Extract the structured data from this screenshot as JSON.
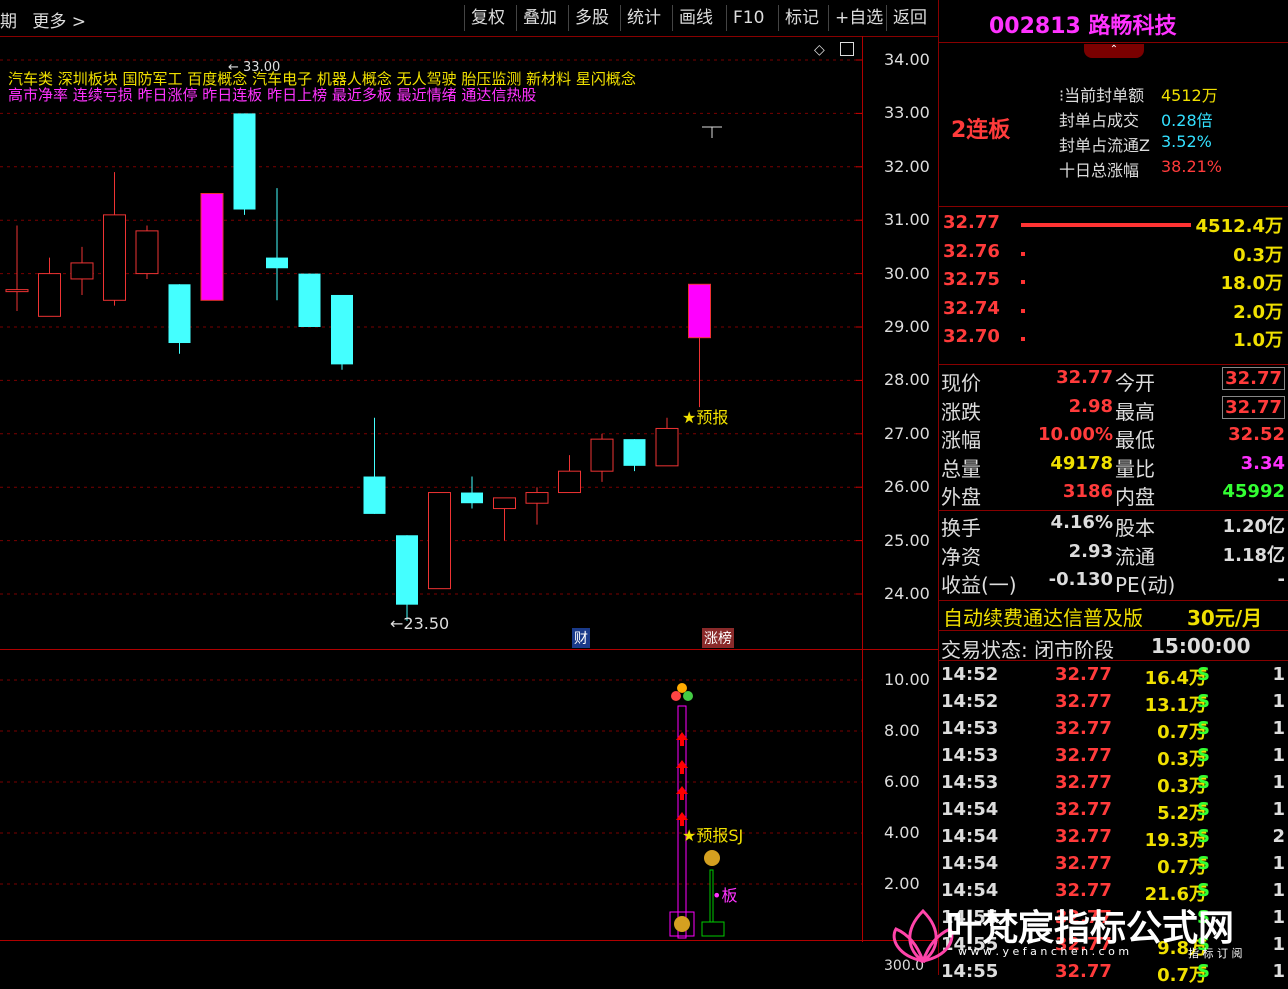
{
  "toolbar": {
    "left_items": [
      "期",
      "更多 >"
    ],
    "buttons": [
      "复权",
      "叠加",
      "多股",
      "统计",
      "画线",
      "F10",
      "标记",
      "+自选",
      "返回"
    ]
  },
  "concepts_row1": "汽车类    深圳板块  国防军工 百度概念 汽车电子 机器人概念 无人驾驶 胎压监测 新材料 星闪概念",
  "concepts_row2": "高市净率 连续亏损 昨日涨停 昨日连板 昨日上榜 最近多板 最近情绪 通达信热股",
  "annotations": {
    "max_label": "← 33.00",
    "min_label": "←23.50",
    "forecast": "★预报",
    "forecast_sj": "★预报SJ",
    "board": "•板",
    "cai": "财",
    "zhangbang": "涨榜"
  },
  "main_axis": [
    "34.00",
    "33.00",
    "32.00",
    "31.00",
    "30.00",
    "29.00",
    "28.00",
    "27.00",
    "26.00",
    "25.00",
    "24.00"
  ],
  "sub_axis": [
    "10.00",
    "8.00",
    "6.00",
    "4.00",
    "2.00"
  ],
  "bottom_axis": "300.0",
  "chart_data": {
    "type": "candlestick",
    "candles": [
      {
        "o": 29.7,
        "h": 30.9,
        "l": 29.3,
        "c": 29.7
      },
      {
        "o": 29.2,
        "h": 30.3,
        "l": 29.2,
        "c": 30.0
      },
      {
        "o": 29.9,
        "h": 30.5,
        "l": 29.6,
        "c": 30.2
      },
      {
        "o": 29.5,
        "h": 31.9,
        "l": 29.4,
        "c": 31.1
      },
      {
        "o": 30.0,
        "h": 30.9,
        "l": 29.9,
        "c": 30.8
      },
      {
        "o": 29.8,
        "h": 29.8,
        "l": 28.5,
        "c": 28.7
      },
      {
        "o": 29.5,
        "h": 31.5,
        "l": 29.5,
        "c": 31.5
      },
      {
        "o": 33.0,
        "h": 33.0,
        "l": 31.1,
        "c": 31.2
      },
      {
        "o": 30.3,
        "h": 31.6,
        "l": 29.5,
        "c": 30.1
      },
      {
        "o": 30.0,
        "h": 30.0,
        "l": 29.0,
        "c": 29.0
      },
      {
        "o": 29.6,
        "h": 29.6,
        "l": 28.2,
        "c": 28.3
      },
      {
        "o": 26.2,
        "h": 27.3,
        "l": 25.5,
        "c": 25.5
      },
      {
        "o": 25.1,
        "h": 25.1,
        "l": 23.5,
        "c": 23.8
      },
      {
        "o": 24.1,
        "h": 25.9,
        "l": 24.1,
        "c": 25.9
      },
      {
        "o": 25.9,
        "h": 26.2,
        "l": 25.6,
        "c": 25.7
      },
      {
        "o": 25.6,
        "h": 25.8,
        "l": 25.0,
        "c": 25.8
      },
      {
        "o": 25.7,
        "h": 26.0,
        "l": 25.3,
        "c": 25.9
      },
      {
        "o": 25.9,
        "h": 26.6,
        "l": 25.9,
        "c": 26.3
      },
      {
        "o": 26.3,
        "h": 27.0,
        "l": 26.1,
        "c": 26.9
      },
      {
        "o": 26.9,
        "h": 26.9,
        "l": 26.3,
        "c": 26.4
      },
      {
        "o": 26.4,
        "h": 27.3,
        "l": 26.4,
        "c": 27.1
      },
      {
        "o": 28.8,
        "h": 29.8,
        "l": 27.5,
        "c": 29.8
      }
    ],
    "y_range": [
      23.5,
      34.3
    ]
  },
  "right": {
    "code": "002813",
    "name": "路畅科技",
    "board_label": "2连板",
    "seal_items": [
      {
        "label": "当前封单额",
        "value": "4512万",
        "color": "yel"
      },
      {
        "label": "封单占成交",
        "value": "0.28倍",
        "color": "cyan"
      },
      {
        "label": "封单占流通Z",
        "value": "3.52%",
        "color": "cyan"
      },
      {
        "label": "十日总涨幅",
        "value": "38.21%",
        "color": "red"
      }
    ],
    "quotes": [
      {
        "price": "32.77",
        "vol": "4512.4万"
      },
      {
        "price": "32.76",
        "vol": "0.3万"
      },
      {
        "price": "32.75",
        "vol": "18.0万"
      },
      {
        "price": "32.74",
        "vol": "2.0万"
      },
      {
        "price": "32.70",
        "vol": "1.0万"
      }
    ],
    "stats1": [
      {
        "l1": "现价",
        "v1": "32.77",
        "c1": "red",
        "l2": "今开",
        "v2": "32.77",
        "c2": "red"
      },
      {
        "l1": "涨跌",
        "v1": "2.98",
        "c1": "red",
        "l2": "最高",
        "v2": "32.77",
        "c2": "red"
      },
      {
        "l1": "涨幅",
        "v1": "10.00%",
        "c1": "red",
        "l2": "最低",
        "v2": "32.52",
        "c2": "red"
      },
      {
        "l1": "总量",
        "v1": "49178",
        "c1": "yel",
        "l2": "量比",
        "v2": "3.34",
        "c2": "mag"
      },
      {
        "l1": "外盘",
        "v1": "3186",
        "c1": "red",
        "l2": "内盘",
        "v2": "45992",
        "c2": "grn"
      }
    ],
    "stats2": [
      {
        "l1": "换手",
        "v1": "4.16%",
        "l2": "股本",
        "v2": "1.20亿"
      },
      {
        "l1": "净资",
        "v1": "2.93",
        "l2": "流通",
        "v2": "1.18亿"
      },
      {
        "l1": "收益(一)",
        "v1": "-0.130",
        "l2": "PE(动)",
        "v2": "-"
      }
    ],
    "promo": "自动续费通达信普及版",
    "promo_price": "30元/月",
    "trade_status_label": "交易状态: 闭市阶段",
    "trade_status_time": "15:00:00",
    "ticks": [
      {
        "t": "14:52",
        "p": "32.77",
        "v": "16.4万",
        "s": "S",
        "n": "1"
      },
      {
        "t": "14:52",
        "p": "32.77",
        "v": "13.1万",
        "s": "S",
        "n": "1"
      },
      {
        "t": "14:53",
        "p": "32.77",
        "v": "0.7万",
        "s": "S",
        "n": "1"
      },
      {
        "t": "14:53",
        "p": "32.77",
        "v": "0.3万",
        "s": "S",
        "n": "1"
      },
      {
        "t": "14:53",
        "p": "32.77",
        "v": "0.3万",
        "s": "S",
        "n": "1"
      },
      {
        "t": "14:54",
        "p": "32.77",
        "v": "5.2万",
        "s": "S",
        "n": "1"
      },
      {
        "t": "14:54",
        "p": "32.77",
        "v": "19.3万",
        "s": "S",
        "n": "2"
      },
      {
        "t": "14:54",
        "p": "32.77",
        "v": "0.7万",
        "s": "S",
        "n": "1"
      },
      {
        "t": "14:54",
        "p": "32.77",
        "v": "21.6万",
        "s": "S",
        "n": "1"
      },
      {
        "t": "14:55",
        "p": "32.77",
        "v": "",
        "s": "S",
        "n": "1"
      },
      {
        "t": "14:55",
        "p": "32.77",
        "v": "9.8万",
        "s": "S",
        "n": "1"
      },
      {
        "t": "14:55",
        "p": "32.77",
        "v": "0.7万",
        "s": "S",
        "n": "1"
      }
    ]
  },
  "watermark": {
    "title": "叶梵宸指标公式网",
    "url": "w w w . y e f a n c h e n . c o m",
    "sub": "指 标 订 阅"
  }
}
